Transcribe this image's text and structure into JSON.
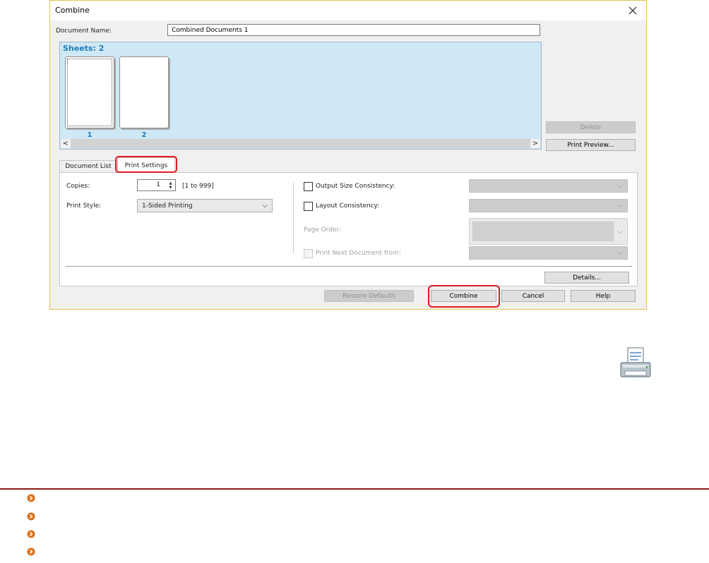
{
  "window": {
    "title": "Combine"
  },
  "document_name": {
    "label": "Document Name:",
    "value": "Combined Documents 1"
  },
  "preview": {
    "sheets_label": "Sheets: 2",
    "sheets": [
      {
        "number": "1"
      },
      {
        "number": "2"
      }
    ],
    "scroll_left": "<",
    "scroll_right": ">"
  },
  "side_buttons": {
    "delete": "Delete",
    "print_preview": "Print Preview..."
  },
  "tabs": [
    {
      "label": "Document List"
    },
    {
      "label": "Print Settings"
    }
  ],
  "print_settings": {
    "copies_label": "Copies:",
    "copies_value": "1",
    "copies_range": "[1 to 999]",
    "print_style_label": "Print Style:",
    "print_style_value": "1-Sided Printing",
    "output_size_label": "Output Size Consistency:",
    "layout_label": "Layout Consistency:",
    "page_order_label": "Page Order:",
    "print_next_label": "Print Next Document from:",
    "details_button": "Details..."
  },
  "bottom_buttons": {
    "restore_defaults": "Restore Defaults",
    "combine": "Combine",
    "cancel": "Cancel",
    "help": "Help"
  },
  "colors": {
    "highlight": "#e11b23",
    "preview_bg": "#cfe8f5",
    "sheet_number": "#1f7db6",
    "rule": "#8c1a1a",
    "bullet": "#d9701c"
  },
  "icons": [
    "close-icon",
    "spin-updown-icon",
    "chevron-down-icon",
    "printer-icon",
    "bullet-arrow-icon"
  ]
}
